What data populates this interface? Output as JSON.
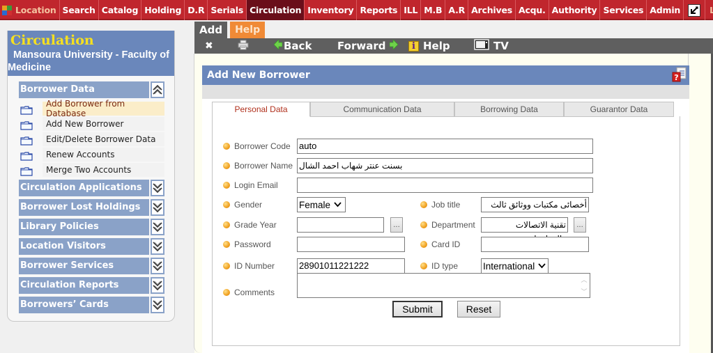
{
  "topnav": {
    "items": [
      {
        "label": "Location",
        "icon": "location-icon"
      },
      {
        "label": "Search"
      },
      {
        "label": "Catalog"
      },
      {
        "label": "Holding"
      },
      {
        "label": "D.R"
      },
      {
        "label": "Serials"
      },
      {
        "label": "Circulation",
        "active": true
      },
      {
        "label": "Inventory"
      },
      {
        "label": "Reports"
      },
      {
        "label": "ILL"
      },
      {
        "label": "M.B"
      },
      {
        "label": "A.R"
      },
      {
        "label": "Archives"
      },
      {
        "label": "Acqu."
      },
      {
        "label": "Authority"
      },
      {
        "label": "Services"
      },
      {
        "label": "Admin"
      }
    ],
    "fullscreen_icon": "fullscreen-toggle-icon",
    "logoff_label": "Log off",
    "colors": {
      "bar": "#c0262d",
      "active": "#6a0e1a",
      "location_text": "#f4c2a0"
    }
  },
  "sidebar": {
    "title": "Circulation",
    "subtitle_line1": "Mansoura University - Faculty of",
    "subtitle_line2": "Medicine",
    "expanded_section": {
      "label": "Borrower Data",
      "toggle_icon": "collapse-up-icon",
      "items": [
        {
          "label": "Add Borrower from Database",
          "highlight": true
        },
        {
          "label": "Add New Borrower"
        },
        {
          "label": "Edit/Delete Borrower Data"
        },
        {
          "label": "Renew Accounts"
        },
        {
          "label": "Merge Two Accounts"
        }
      ]
    },
    "collapsed_sections": [
      {
        "label": "Circulation Applications"
      },
      {
        "label": "Borrower Lost Holdings"
      },
      {
        "label": "Library Policies"
      },
      {
        "label": "Location Visitors"
      },
      {
        "label": "Borrower Services"
      },
      {
        "label": "Circulation Reports"
      },
      {
        "label": "Borrowers’ Cards"
      }
    ]
  },
  "main": {
    "tabs": [
      {
        "label": "Add"
      },
      {
        "label": "Help"
      }
    ],
    "toolbar": {
      "close_icon": "close-icon",
      "print_icon": "print-icon",
      "back_label": "Back",
      "forward_label": "Forward",
      "help_label": "Help",
      "tv_label": "TV"
    },
    "panel": {
      "title": "Add New Borrower",
      "help_icon": "help-document-icon",
      "form_tabs": [
        {
          "label": "Personal Data",
          "active": true
        },
        {
          "label": "Communication Data"
        },
        {
          "label": "Borrowing Data"
        },
        {
          "label": "Guarantor Data"
        }
      ],
      "fields": {
        "borrower_code": {
          "label": "Borrower Code",
          "value": "auto"
        },
        "borrower_name": {
          "label": "Borrower Name",
          "value": "بسنت عنتر شهاب احمد الشال"
        },
        "login_email": {
          "label": "Login Email",
          "value": ""
        },
        "gender": {
          "label": "Gender",
          "value": "Female"
        },
        "job_title": {
          "label": "Job title",
          "value": "أخصائى مكتبات ووثائق ثالث"
        },
        "grade_year": {
          "label": "Grade Year",
          "value": ""
        },
        "department": {
          "label": "Department",
          "value": "تقنية الاتصالات والمعلومات"
        },
        "password": {
          "label": "Password",
          "value": ""
        },
        "card_id": {
          "label": "Card ID",
          "value": ""
        },
        "id_number": {
          "label": "ID Number",
          "value": "28901011221222"
        },
        "id_type": {
          "label": "ID type",
          "value": "International"
        },
        "comments": {
          "label": "Comments",
          "value": ""
        }
      },
      "browse_label": "...",
      "submit_label": "Submit",
      "reset_label": "Reset"
    }
  }
}
